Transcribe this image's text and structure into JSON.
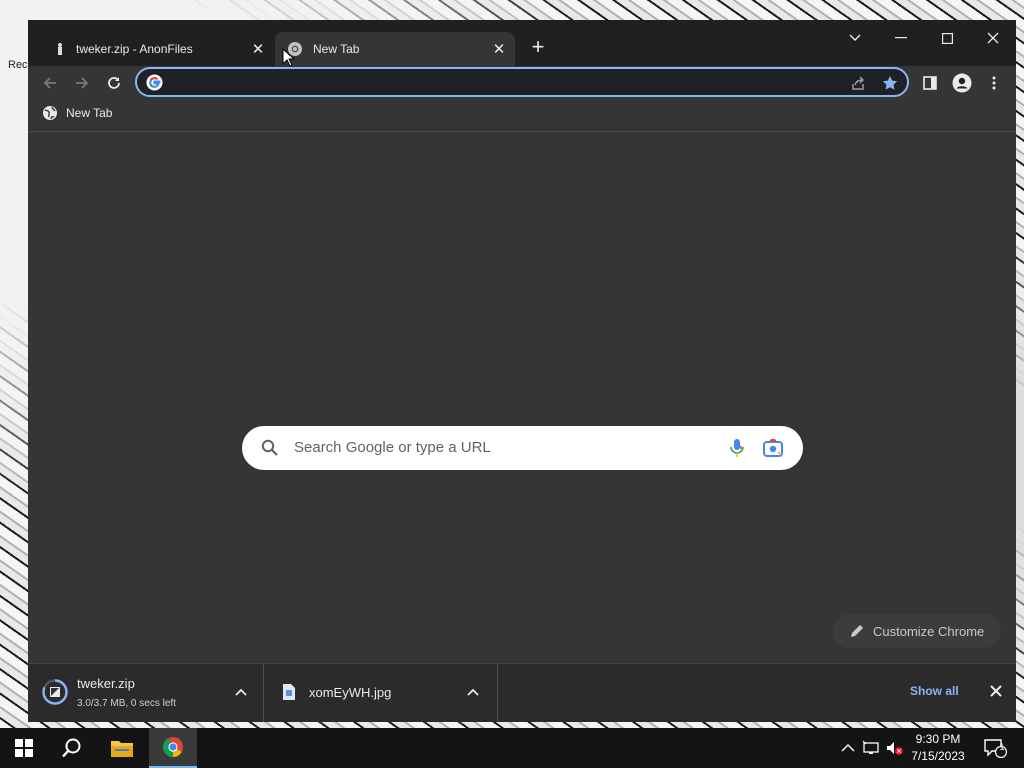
{
  "desktop": {
    "partial_label": "Rec"
  },
  "tabs": [
    {
      "title": "tweker.zip - AnonFiles",
      "active": false
    },
    {
      "title": "New Tab",
      "active": true
    }
  ],
  "omnibox": {
    "value": ""
  },
  "bookmarks_bar": {
    "items": [
      {
        "label": "New Tab",
        "icon": "globe-icon"
      }
    ]
  },
  "ntp": {
    "search_placeholder": "Search Google or type a URL",
    "customize_label": "Customize Chrome"
  },
  "downloads": {
    "items": [
      {
        "filename": "tweker.zip",
        "status": "3.0/3.7 MB, 0 secs left",
        "progress": 0.81
      },
      {
        "filename": "xomEyWH.jpg",
        "status": ""
      }
    ],
    "show_all_label": "Show all"
  },
  "taskbar": {
    "time": "9:30 PM",
    "date": "7/15/2023",
    "notification_count": "1"
  },
  "colors": {
    "accent": "#8ab4f8",
    "tab_bg": "#202020",
    "content_bg": "#353535",
    "shelf_bg": "#2b2b2b",
    "taskbar_bg": "#141414"
  }
}
